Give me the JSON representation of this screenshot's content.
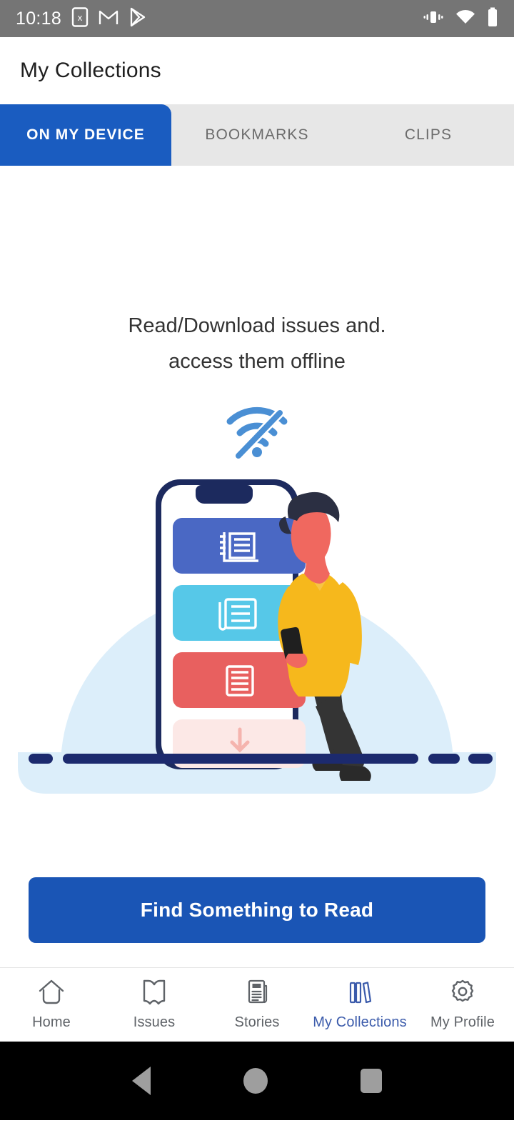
{
  "statusbar": {
    "time": "10:18",
    "left_icons": [
      "sim-card-x-icon",
      "gmail-icon",
      "play-store-icon"
    ],
    "right_icons": [
      "vibrate-icon",
      "wifi-icon",
      "battery-icon"
    ],
    "background": "#757575",
    "foreground": "#ffffff"
  },
  "appbar": {
    "title": "My Collections"
  },
  "tabs": {
    "active_index": 0,
    "active_color": "#1a5cc0",
    "bar_background": "#e7e7e7",
    "items": [
      {
        "label": "ON MY DEVICE"
      },
      {
        "label": "BOOKMARKS"
      },
      {
        "label": "CLIPS"
      }
    ]
  },
  "empty_state": {
    "line1": "Read/Download issues and.",
    "line2": "access them offline",
    "icon": "wifi-off-icon",
    "icon_color": "#4a8fd4",
    "illustration": {
      "name": "offline-reading-illustration",
      "dome_color": "#dceefa",
      "phone_frame_color": "#1c2a5e",
      "ground_color": "#1c2a6e",
      "cards": [
        {
          "name": "newspaper-card",
          "color": "#4a68c4",
          "icon": "newspaper-icon"
        },
        {
          "name": "magazine-card",
          "color": "#56c8e8",
          "icon": "magazine-icon"
        },
        {
          "name": "article-card",
          "color": "#e8605f",
          "icon": "article-icon"
        },
        {
          "name": "download-card",
          "color": "#fce8e6",
          "icon": "download-icon"
        }
      ],
      "person": {
        "shirt_color": "#f6b81c",
        "pants_color": "#343434",
        "hair_color": "#2b2f42",
        "skin_color": "#f0685f"
      }
    }
  },
  "cta": {
    "label": "Find Something to Read",
    "color": "#1a55b5"
  },
  "bottom_nav": {
    "active_index": 3,
    "active_color": "#3b5bab",
    "inactive_color": "#5f6368",
    "items": [
      {
        "label": "Home",
        "icon": "home-icon"
      },
      {
        "label": "Issues",
        "icon": "book-open-icon"
      },
      {
        "label": "Stories",
        "icon": "article-page-icon"
      },
      {
        "label": "My Collections",
        "icon": "books-shelf-icon"
      },
      {
        "label": "My Profile",
        "icon": "gear-icon"
      }
    ]
  },
  "system_nav": {
    "background": "#000000",
    "buttons": [
      {
        "name": "back-button"
      },
      {
        "name": "home-button"
      },
      {
        "name": "recents-button"
      }
    ]
  }
}
